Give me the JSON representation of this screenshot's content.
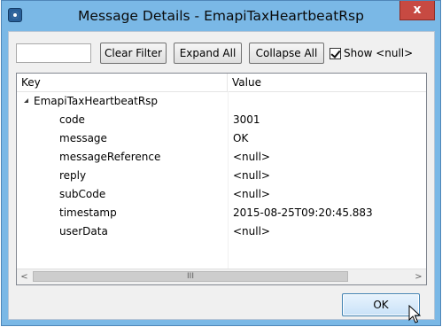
{
  "window": {
    "title": "Message Details - EmapiTaxHeartbeatRsp",
    "close_glyph": "x",
    "app_icon": "app-icon"
  },
  "toolbar": {
    "filter_value": "",
    "clear_filter_label": "Clear Filter",
    "expand_all_label": "Expand All",
    "collapse_all_label": "Collapse All",
    "show_null_label": "Show <null>",
    "show_null_checked": true
  },
  "table": {
    "columns": [
      "Key",
      "Value"
    ],
    "root": {
      "key": "EmapiTaxHeartbeatRsp",
      "value": ""
    },
    "rows": [
      {
        "key": "code",
        "value": "3001"
      },
      {
        "key": "message",
        "value": "OK"
      },
      {
        "key": "messageReference",
        "value": "<null>"
      },
      {
        "key": "reply",
        "value": "<null>"
      },
      {
        "key": "subCode",
        "value": "<null>"
      },
      {
        "key": "timestamp",
        "value": "2015-08-25T09:20:45.883"
      },
      {
        "key": "userData",
        "value": "<null>"
      }
    ],
    "scroll_left_glyph": "<",
    "scroll_right_glyph": ">",
    "scroll_thumb_grip": "III"
  },
  "footer": {
    "ok_label": "OK"
  },
  "colors": {
    "title_bar": "#7ab8e6",
    "close_button": "#c74a42"
  }
}
